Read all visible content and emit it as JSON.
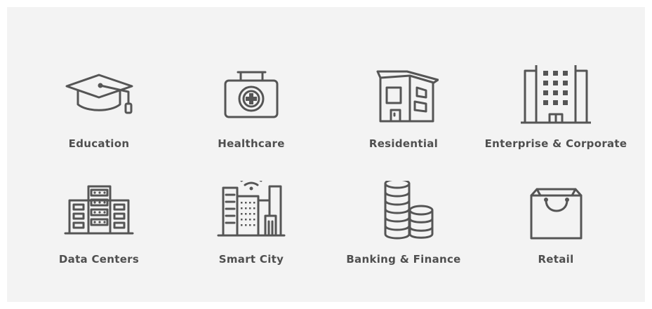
{
  "categories": [
    {
      "label": "Education",
      "icon": "graduation-cap-icon"
    },
    {
      "label": "Healthcare",
      "icon": "first-aid-kit-icon"
    },
    {
      "label": "Residential",
      "icon": "house-icon"
    },
    {
      "label": "Enterprise & Corporate",
      "icon": "office-building-icon"
    },
    {
      "label": "Data Centers",
      "icon": "server-buildings-icon"
    },
    {
      "label": "Smart City",
      "icon": "smart-city-wifi-icon"
    },
    {
      "label": "Banking & Finance",
      "icon": "coin-stacks-icon"
    },
    {
      "label": "Retail",
      "icon": "shopping-bag-icon"
    }
  ],
  "colors": {
    "panel_bg": "#f3f3f3",
    "icon": "#555555",
    "label": "#4f4f4f"
  }
}
